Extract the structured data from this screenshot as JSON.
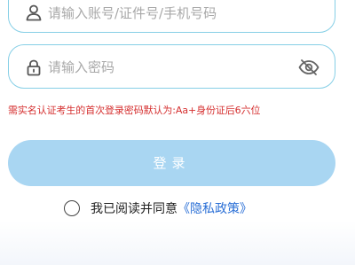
{
  "account": {
    "placeholder": "请输入账号/证件号/手机号码",
    "icon": "user-icon"
  },
  "password": {
    "placeholder": "请输入密码",
    "icon": "lock-icon",
    "toggle_icon": "eye-off-icon"
  },
  "notice": "需实名认证考生的首次登录密码默认为:Aa+身份证后6六位",
  "login_button": "登录",
  "agreement": {
    "text": "我已阅读并同意",
    "link": "《隐私政策》"
  },
  "colors": {
    "field_border": "#86cfe6",
    "notice": "#d52f2f",
    "button": "#a9d6f2",
    "link": "#2a6fd6"
  }
}
